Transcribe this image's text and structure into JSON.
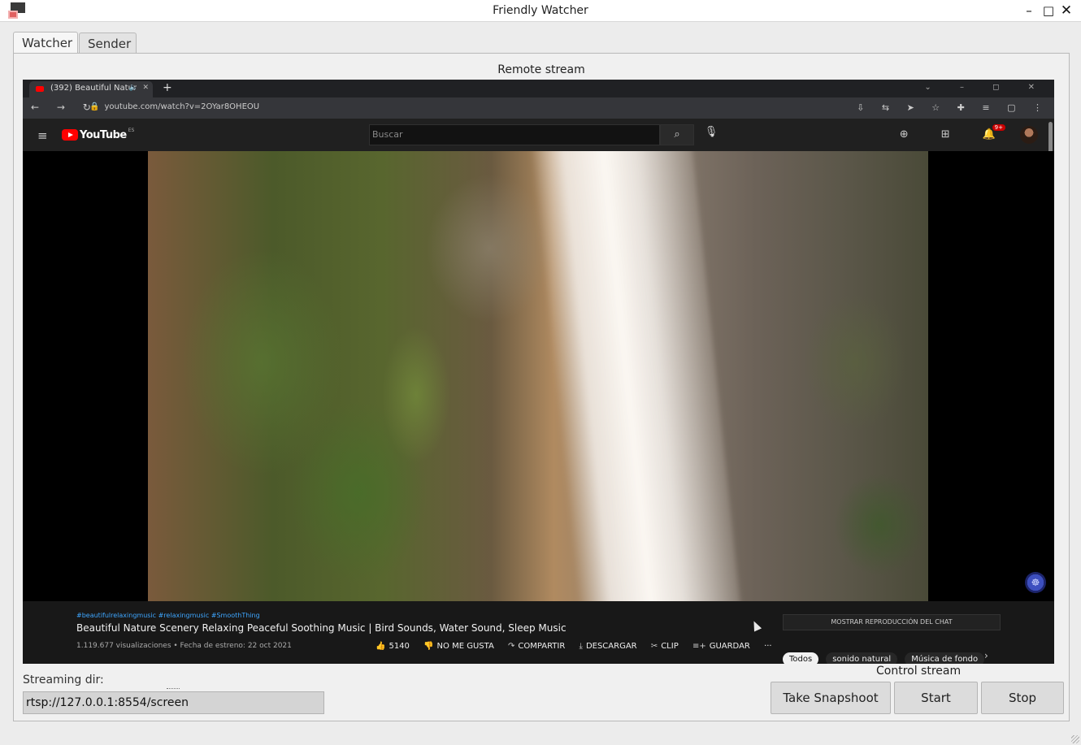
{
  "window": {
    "title": "Friendly Watcher",
    "minimize_glyph": "–",
    "maximize_glyph": "□",
    "close_glyph": "✕"
  },
  "tabs": [
    {
      "label": "Watcher",
      "active": true
    },
    {
      "label": "Sender",
      "active": false
    }
  ],
  "remote_stream": {
    "label": "Remote stream",
    "browser": {
      "tab_title": "(392) Beautiful Natur",
      "new_tab_glyph": "+",
      "url": "youtube.com/watch?v=2OYar8OHEOU",
      "window_glyphs": "⌄ – ◻ ✕",
      "nav_glyphs": "← → ↻",
      "ext_glyphs": "⇩ ⇆ ➤ ☆ ✚ ≡ ▢ ⋮"
    },
    "youtube": {
      "logo_text": "YouTube",
      "logo_region": "ES",
      "search_placeholder": "Buscar",
      "notification_count": "9+",
      "hashtags": "#beautifulrelaxingmusic #relaxingmusic #SmoothThing",
      "video_title": "Beautiful Nature Scenery Relaxing Peaceful Soothing Music | Bird Sounds, Water Sound, Sleep Music",
      "video_meta": "1.119.677 visualizaciones • Fecha de estreno: 22 oct 2021",
      "likes": "5140",
      "dislike_label": "NO ME GUSTA",
      "share_label": "COMPARTIR",
      "download_label": "DESCARGAR",
      "clip_label": "CLIP",
      "save_label": "GUARDAR",
      "more_glyph": "···",
      "chat_replay_label": "MOSTRAR REPRODUCCIÓN DEL CHAT",
      "chips": [
        "Todos",
        "sonido natural",
        "Música de fondo"
      ],
      "chips_next_glyph": "›"
    }
  },
  "streaming": {
    "dir_label": "Streaming dir:",
    "dir_value": "rtsp://127.0.0.1:8554/screen"
  },
  "control": {
    "label": "Control stream",
    "snapshot_label": "Take Snapshoot",
    "start_label": "Start",
    "stop_label": "Stop"
  },
  "colors": {
    "window_bg": "#ececec",
    "youtube_red": "#ff0000",
    "link_blue": "#3ea6ff"
  }
}
